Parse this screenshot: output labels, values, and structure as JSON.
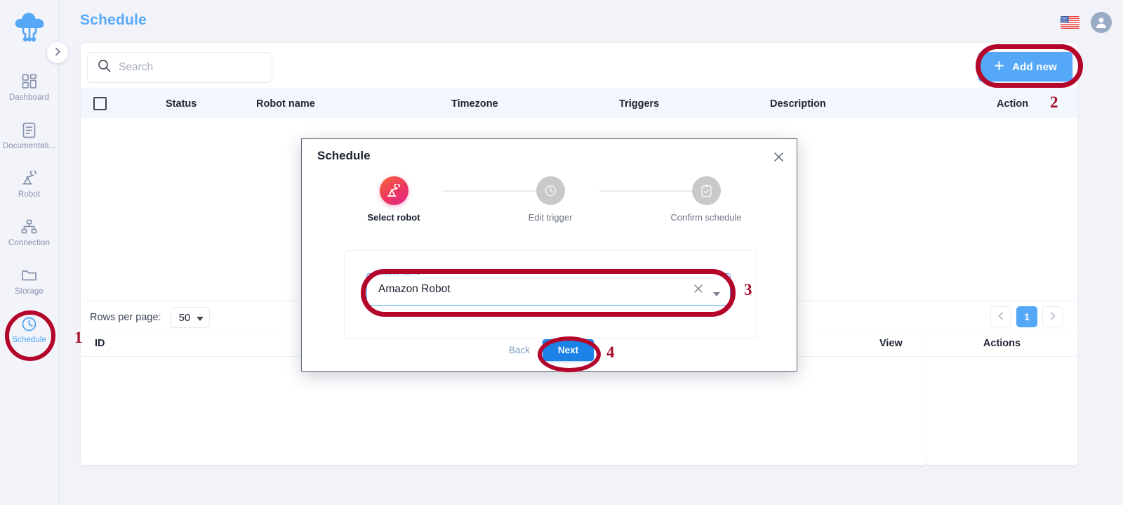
{
  "app": {
    "logo_icon": "cloud-network-logo",
    "page_title": "Schedule"
  },
  "header": {
    "language_flag": "us-flag-icon",
    "account_icon": "user-avatar-icon"
  },
  "sidebar": {
    "collapse_icon": "chevron-right-icon",
    "items": [
      {
        "label": "Dashboard",
        "icon": "dashboard-grid-icon",
        "active": false
      },
      {
        "label": "Documentati...",
        "icon": "document-icon",
        "active": false
      },
      {
        "label": "Robot",
        "icon": "robot-arm-icon",
        "active": false
      },
      {
        "label": "Connection",
        "icon": "sitemap-icon",
        "active": false
      },
      {
        "label": "Storage",
        "icon": "folder-icon",
        "active": false
      },
      {
        "label": "Schedule",
        "icon": "clock-icon",
        "active": true
      }
    ]
  },
  "toolbar": {
    "search_placeholder": "Search",
    "search_value": "",
    "search_icon": "search-icon",
    "add_new_label": "Add new",
    "add_new_icon": "plus-icon"
  },
  "table": {
    "columns": [
      "Status",
      "Robot name",
      "Timezone",
      "Triggers",
      "Description",
      "Action"
    ],
    "select_all_checkbox": "unchecked",
    "rows": []
  },
  "footer": {
    "rows_per_page_label": "Rows per page:",
    "rows_per_page_value": "50",
    "dropdown_icon": "caret-down-icon",
    "prev_icon": "chevron-left-icon",
    "next_icon": "chevron-right-icon",
    "current_page": "1"
  },
  "lower_tables": {
    "left_columns": [
      "ID",
      "View"
    ],
    "right_columns": [
      "Actions"
    ],
    "rows": []
  },
  "modal": {
    "title": "Schedule",
    "close_icon": "close-x-icon",
    "steps": [
      {
        "label": "Select robot",
        "icon": "robot-arm-icon",
        "active": true
      },
      {
        "label": "Edit trigger",
        "icon": "clock-icon",
        "active": false
      },
      {
        "label": "Confirm schedule",
        "icon": "clipboard-check-icon",
        "active": false
      }
    ],
    "robot_field": {
      "label": "Robot name",
      "value": "Amazon Robot",
      "clear_icon": "clear-x-icon",
      "dropdown_icon": "caret-down-icon"
    },
    "back_label": "Back",
    "next_label": "Next"
  },
  "annotations": {
    "color": "#b4062b",
    "markers": [
      {
        "number": "1",
        "target": "sidebar-item-schedule"
      },
      {
        "number": "2",
        "target": "add-new-button"
      },
      {
        "number": "3",
        "target": "robot-name-field"
      },
      {
        "number": "4",
        "target": "next-button"
      }
    ]
  },
  "colors": {
    "brand_blue": "#54a8f7",
    "page_bg": "#f1f3f9",
    "sidebar_bg": "#f2f4fa",
    "header_row_bg": "#f2f7fd",
    "annotation_red": "#b4062b"
  }
}
